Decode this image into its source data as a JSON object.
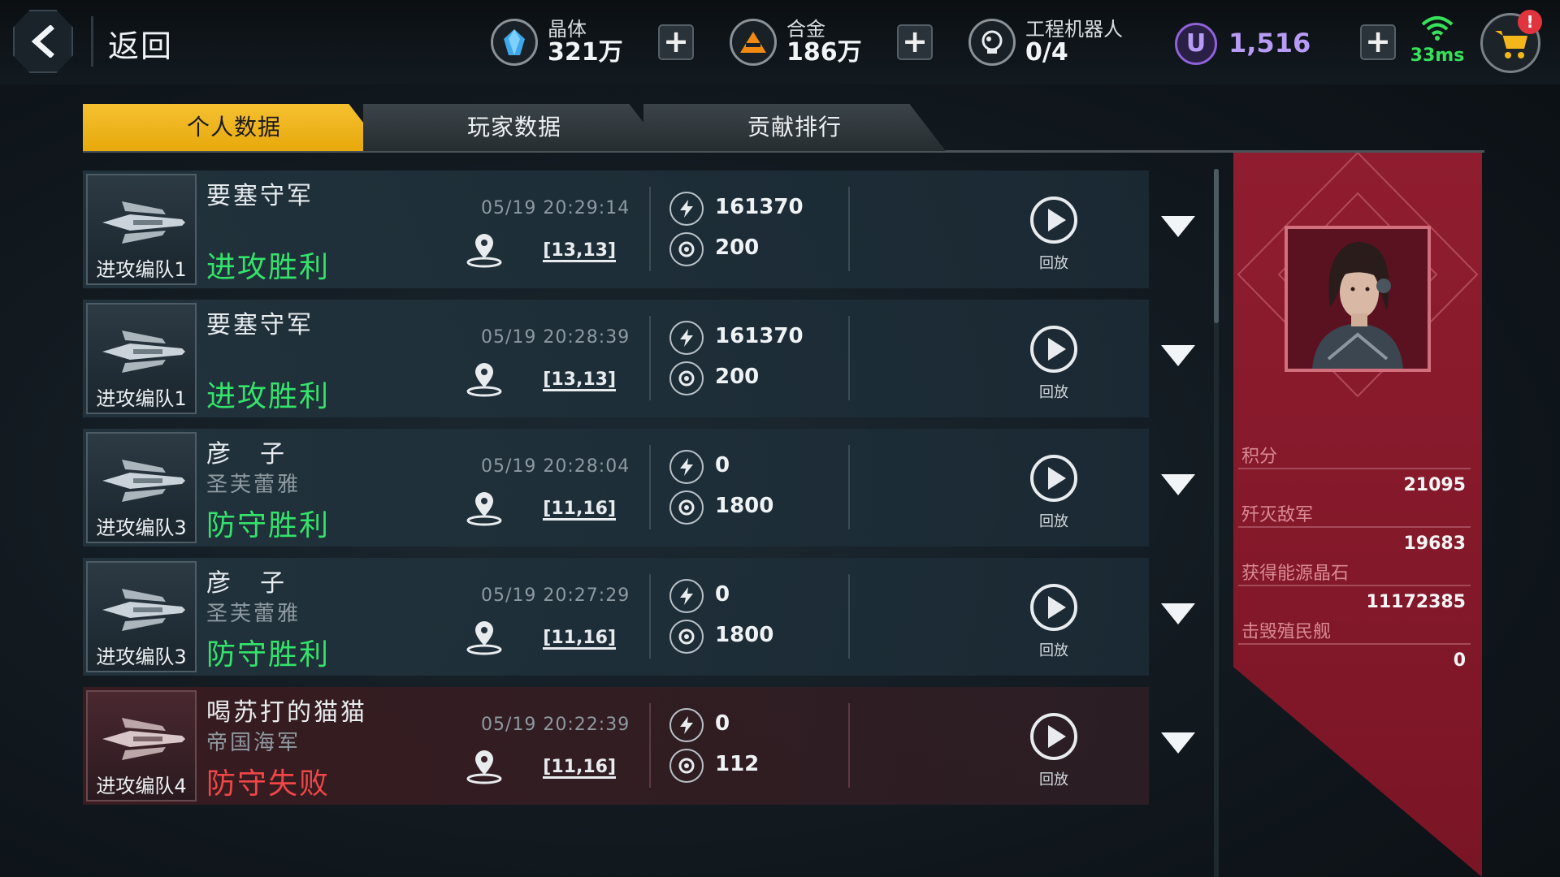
{
  "topbar": {
    "back_label": "返回",
    "resources": [
      {
        "label": "晶体",
        "value": "321万",
        "icon": "crystal-icon"
      },
      {
        "label": "合金",
        "value": "186万",
        "icon": "alloy-icon"
      },
      {
        "label": "工程机器人",
        "value": "0/4",
        "icon": "robot-icon"
      }
    ],
    "premium": {
      "symbol": "U",
      "value": "1,516"
    },
    "ping": "33ms",
    "cart_badge": "!"
  },
  "tabs": [
    {
      "label": "个人数据",
      "active": true
    },
    {
      "label": "玩家数据",
      "active": false
    },
    {
      "label": "贡献排行",
      "active": false
    }
  ],
  "records": [
    {
      "fleet": "进攻编队1",
      "opponent": "要塞守军",
      "guild": "",
      "result": "进攻胜利",
      "outcome": "win",
      "time": "05/19 20:29:14",
      "coord": "[13,13]",
      "power": "161370",
      "score": "200",
      "replay_label": "回放"
    },
    {
      "fleet": "进攻编队1",
      "opponent": "要塞守军",
      "guild": "",
      "result": "进攻胜利",
      "outcome": "win",
      "time": "05/19 20:28:39",
      "coord": "[13,13]",
      "power": "161370",
      "score": "200",
      "replay_label": "回放"
    },
    {
      "fleet": "进攻编队3",
      "opponent": "彦　子",
      "guild": "圣芙蕾雅",
      "result": "防守胜利",
      "outcome": "win",
      "time": "05/19 20:28:04",
      "coord": "[11,16]",
      "power": "0",
      "score": "1800",
      "replay_label": "回放"
    },
    {
      "fleet": "进攻编队3",
      "opponent": "彦　子",
      "guild": "圣芙蕾雅",
      "result": "防守胜利",
      "outcome": "win",
      "time": "05/19 20:27:29",
      "coord": "[11,16]",
      "power": "0",
      "score": "1800",
      "replay_label": "回放"
    },
    {
      "fleet": "进攻编队4",
      "opponent": "喝苏打的猫猫",
      "guild": "帝国海军",
      "result": "防守失败",
      "outcome": "loss",
      "time": "05/19 20:22:39",
      "coord": "[11,16]",
      "power": "0",
      "score": "112",
      "replay_label": "回放"
    }
  ],
  "panel": {
    "stats": [
      {
        "label": "积分",
        "value": "21095"
      },
      {
        "label": "歼灭敌军",
        "value": "19683"
      },
      {
        "label": "获得能源晶石",
        "value": "11172385"
      },
      {
        "label": "击毁殖民舰",
        "value": "0"
      }
    ]
  },
  "colors": {
    "tab_active": "#f0b41e",
    "win_text": "#33e36a",
    "loss_text": "#f04646",
    "panel_bg": "#8a1a2c",
    "premium": "#b79bf4",
    "ping": "#36e25a"
  }
}
